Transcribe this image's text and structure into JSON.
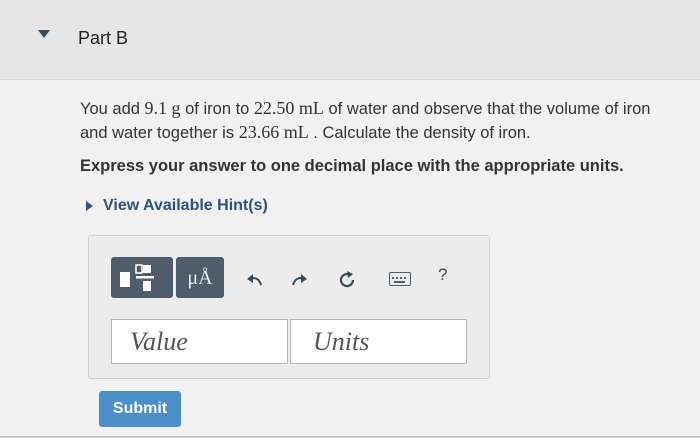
{
  "header": {
    "part_title": "Part B"
  },
  "question": {
    "t1": "You add ",
    "m1": "9.1 g",
    "t2": " of iron to ",
    "m2": "22.50 mL",
    "t3": " of water and observe that the volume of iron and water together is ",
    "m3": "23.66 mL",
    "t4": " . Calculate the density of iron."
  },
  "instruction": "Express your answer to one decimal place with the appropriate units.",
  "hint_label": "View Available Hint(s)",
  "toolbar": {
    "units_label": "μÅ",
    "help_label": "?"
  },
  "inputs": {
    "value_placeholder": "Value",
    "units_placeholder": "Units"
  },
  "submit_label": "Submit",
  "icons": [
    "caret-down-icon",
    "caret-right-icon",
    "fraction-template-icon",
    "undo-icon",
    "redo-icon",
    "reset-icon",
    "keyboard-icon",
    "help-icon"
  ],
  "colors": {
    "header_bg": "#e6e6e6",
    "toolbar_dark": "#4f5d6b",
    "submit_blue": "#4b8fc9",
    "link_blue": "#2c5282"
  }
}
